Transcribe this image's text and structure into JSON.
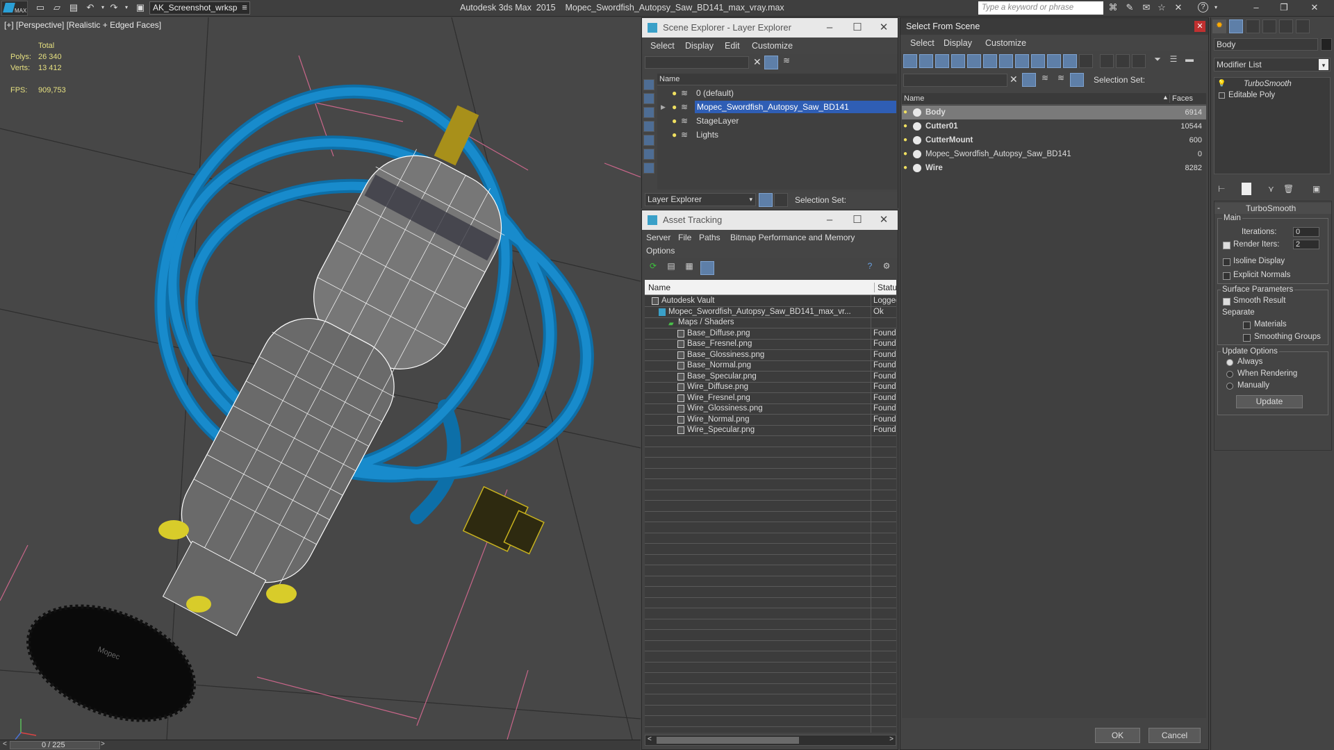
{
  "app": {
    "workspace": "AK_Screenshot_wrksp",
    "title": "Autodesk 3ds Max  2015    Mopec_Swordfish_Autopsy_Saw_BD141_max_vray.max",
    "search_placeholder": "Type a keyword or phrase",
    "logo": "MAX"
  },
  "viewport": {
    "label": "[+] [Perspective] [Realistic + Edged Faces]",
    "stats": {
      "total_label": "Total",
      "polys_label": "Polys:",
      "polys": "26 340",
      "verts_label": "Verts:",
      "verts": "13 412",
      "fps_label": "FPS:",
      "fps": "909,753"
    },
    "frame_counter": "0 / 225",
    "watermark": "Mopec"
  },
  "scene_explorer": {
    "title": "Scene Explorer - Layer Explorer",
    "menu": [
      "Select",
      "Display",
      "Edit",
      "Customize"
    ],
    "column_name": "Name",
    "layers": [
      "0 (default)",
      "Mopec_Swordfish_Autopsy_Saw_BD141",
      "StageLayer",
      "Lights"
    ],
    "footer_dropdown": "Layer Explorer",
    "selection_set_label": "Selection Set:"
  },
  "asset_tracking": {
    "title": "Asset Tracking",
    "menu": [
      "Server",
      "File",
      "Paths",
      "Bitmap Performance and Memory",
      "Options"
    ],
    "columns": [
      "Name",
      "Status"
    ],
    "rows": [
      {
        "name": "Autodesk Vault",
        "status": "Logged"
      },
      {
        "name": "Mopec_Swordfish_Autopsy_Saw_BD141_max_vr...",
        "status": "Ok"
      },
      {
        "name": "Maps / Shaders",
        "status": ""
      },
      {
        "name": "Base_Diffuse.png",
        "status": "Found"
      },
      {
        "name": "Base_Fresnel.png",
        "status": "Found"
      },
      {
        "name": "Base_Glossiness.png",
        "status": "Found"
      },
      {
        "name": "Base_Normal.png",
        "status": "Found"
      },
      {
        "name": "Base_Specular.png",
        "status": "Found"
      },
      {
        "name": "Wire_Diffuse.png",
        "status": "Found"
      },
      {
        "name": "Wire_Fresnel.png",
        "status": "Found"
      },
      {
        "name": "Wire_Glossiness.png",
        "status": "Found"
      },
      {
        "name": "Wire_Normal.png",
        "status": "Found"
      },
      {
        "name": "Wire_Specular.png",
        "status": "Found"
      }
    ]
  },
  "select_from_scene": {
    "title": "Select From Scene",
    "menu": [
      "Select",
      "Display",
      "Customize"
    ],
    "selection_set_label": "Selection Set:",
    "columns": [
      "Name",
      "Faces"
    ],
    "objects": [
      {
        "name": "Body",
        "faces": "6914"
      },
      {
        "name": "Cutter01",
        "faces": "10544"
      },
      {
        "name": "CutterMount",
        "faces": "600"
      },
      {
        "name": "Mopec_Swordfish_Autopsy_Saw_BD141",
        "faces": "0"
      },
      {
        "name": "Wire",
        "faces": "8282"
      }
    ],
    "ok": "OK",
    "cancel": "Cancel"
  },
  "modify_panel": {
    "object_name": "Body",
    "modifier_list": "Modifier List",
    "stack": [
      "TurboSmooth",
      "Editable Poly"
    ],
    "rollout_title": "TurboSmooth",
    "main_label": "Main",
    "iterations_label": "Iterations:",
    "iterations": "0",
    "render_iters_label": "Render Iters:",
    "render_iters": "2",
    "isoline": "Isoline Display",
    "explicit_normals": "Explicit Normals",
    "surface_params": "Surface Parameters",
    "smooth_result": "Smooth Result",
    "separate": "Separate",
    "materials": "Materials",
    "smoothing_groups": "Smoothing Groups",
    "update_options": "Update Options",
    "always": "Always",
    "when_rendering": "When Rendering",
    "manually": "Manually",
    "update": "Update"
  }
}
